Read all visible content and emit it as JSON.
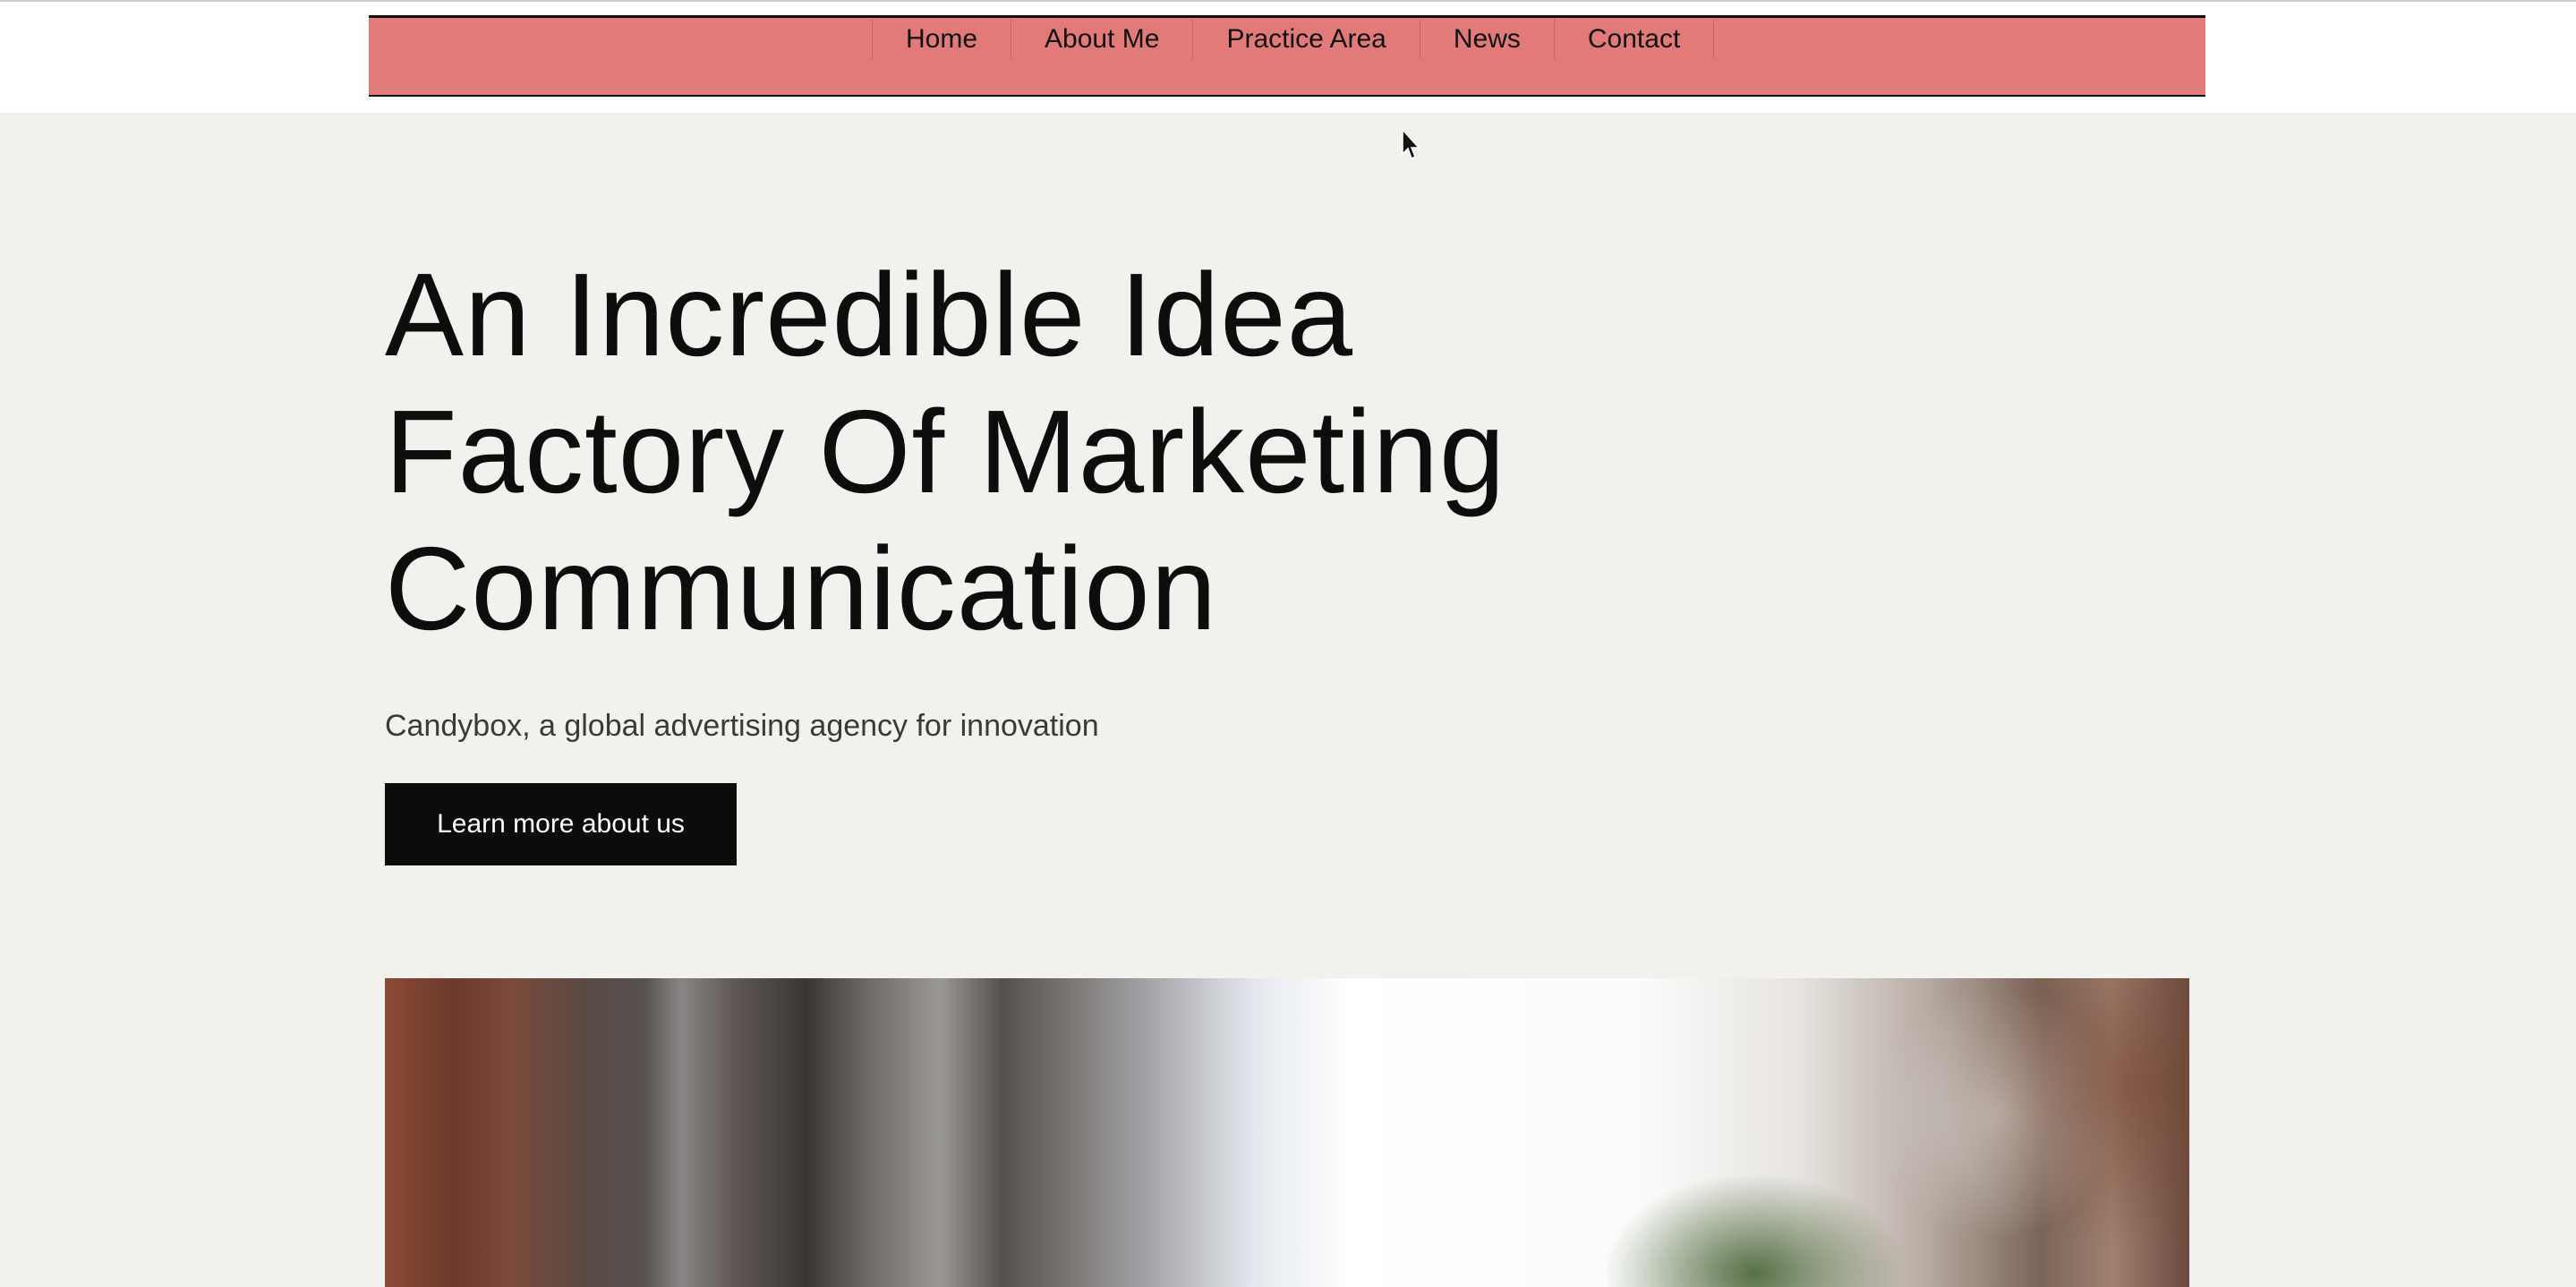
{
  "nav": {
    "items": [
      {
        "label": "Home"
      },
      {
        "label": "About Me"
      },
      {
        "label": "Practice Area"
      },
      {
        "label": "News"
      },
      {
        "label": "Contact"
      }
    ],
    "bar_color": "#e27a7a"
  },
  "hero": {
    "title_lines": [
      "An Incredible Idea",
      "Factory Of Marketing",
      "Communication"
    ],
    "subtitle": "Candybox, a global advertising agency for innovation",
    "cta_label": "Learn more about us"
  },
  "colors": {
    "page_background": "#f2f1ed",
    "button_background": "#0c0c0c",
    "text": "#0f0f0f"
  },
  "icons": {
    "cursor": "mouse-pointer-icon"
  }
}
